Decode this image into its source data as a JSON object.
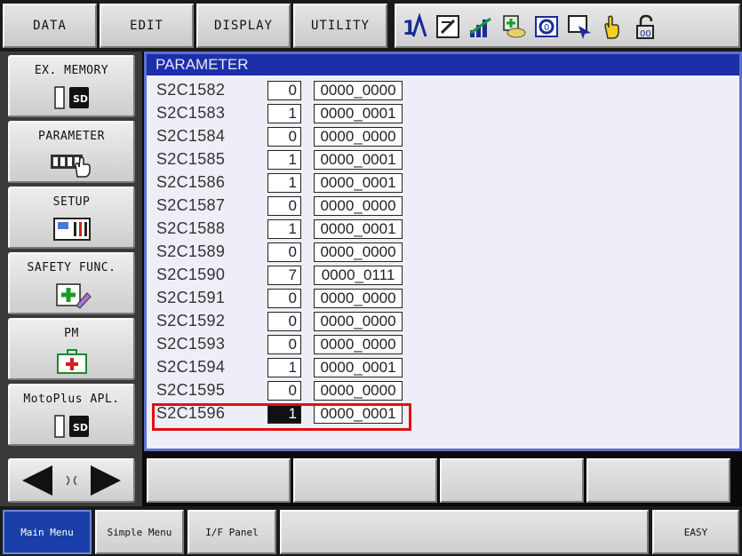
{
  "top_menu": {
    "data": "DATA",
    "edit": "EDIT",
    "display": "DISPLAY",
    "utility": "UTILITY",
    "icons": [
      "language-switch-icon",
      "edit-note-icon",
      "signal-bars-icon",
      "job-list-icon",
      "camera-view-icon",
      "monitor-cursor-icon",
      "hand-touch-icon",
      "security-mode-icon"
    ]
  },
  "left_menu": {
    "ex_memory": "EX. MEMORY",
    "parameter": "PARAMETER",
    "setup": "SETUP",
    "safety_func": "SAFETY FUNC.",
    "pm": "PM",
    "motoplus_apl": "MotoPlus APL."
  },
  "panel": {
    "title": "PARAMETER",
    "rows": [
      {
        "name": "S2C1582",
        "value": "0",
        "binary": "0000_0000"
      },
      {
        "name": "S2C1583",
        "value": "1",
        "binary": "0000_0001"
      },
      {
        "name": "S2C1584",
        "value": "0",
        "binary": "0000_0000"
      },
      {
        "name": "S2C1585",
        "value": "1",
        "binary": "0000_0001"
      },
      {
        "name": "S2C1586",
        "value": "1",
        "binary": "0000_0001"
      },
      {
        "name": "S2C1587",
        "value": "0",
        "binary": "0000_0000"
      },
      {
        "name": "S2C1588",
        "value": "1",
        "binary": "0000_0001"
      },
      {
        "name": "S2C1589",
        "value": "0",
        "binary": "0000_0000"
      },
      {
        "name": "S2C1590",
        "value": "7",
        "binary": "0000_0111"
      },
      {
        "name": "S2C1591",
        "value": "0",
        "binary": "0000_0000"
      },
      {
        "name": "S2C1592",
        "value": "0",
        "binary": "0000_0000"
      },
      {
        "name": "S2C1593",
        "value": "0",
        "binary": "0000_0000"
      },
      {
        "name": "S2C1594",
        "value": "1",
        "binary": "0000_0001"
      },
      {
        "name": "S2C1595",
        "value": "0",
        "binary": "0000_0000"
      },
      {
        "name": "S2C1596",
        "value": "1",
        "binary": "0000_0001"
      }
    ],
    "selected_row": "S2C1596"
  },
  "bottom_bar": {
    "main_menu": "Main Menu",
    "simple_menu": "Simple Menu",
    "if_panel": "I/F Panel",
    "easy": "EASY"
  },
  "colors": {
    "title_bar": "#1c2fa8",
    "panel_bg": "#eeeef8",
    "highlight": "#e01010",
    "active_tab": "#1a3fa8"
  }
}
